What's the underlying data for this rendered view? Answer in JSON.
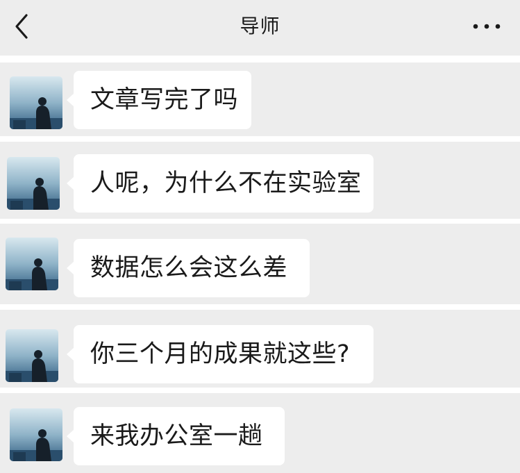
{
  "header": {
    "back_icon": "chevron-left-icon",
    "title": "导师",
    "more_icon": "ellipsis-icon"
  },
  "messages": [
    {
      "text": "文章写完了吗"
    },
    {
      "text": "人呢，为什么不在实验室"
    },
    {
      "text": "数据怎么会这么差"
    },
    {
      "text": "你三个月的成果就这些?"
    },
    {
      "text": "来我办公室一趟"
    }
  ],
  "colors": {
    "chat_background": "#ededed",
    "bubble": "#ffffff",
    "text": "#1a1a1a",
    "separator": "#ffffff"
  }
}
